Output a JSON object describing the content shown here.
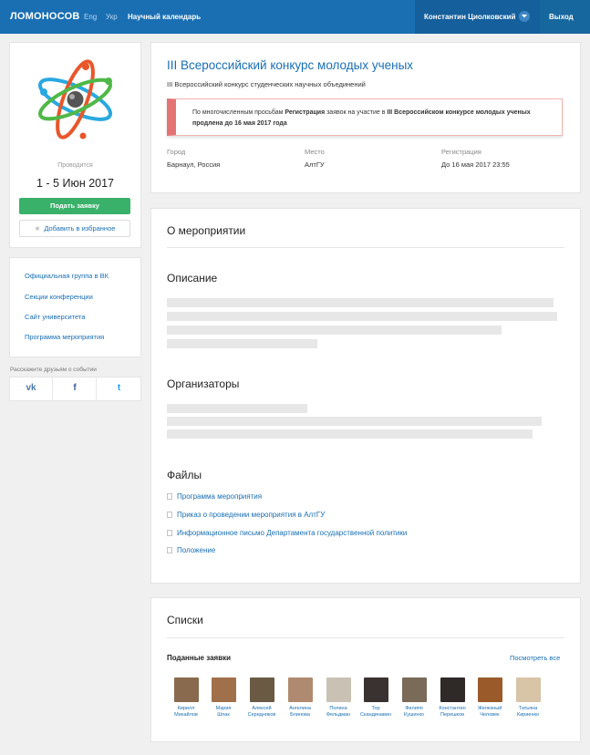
{
  "header": {
    "logo": "ЛОМОНОСОВ",
    "lang_eng": "Eng",
    "lang_ukr": "Укр",
    "nav_calendar": "Научный календарь",
    "user_name": "Константин Циолковский",
    "logout": "Выход"
  },
  "sidebar": {
    "held_label": "Проводится",
    "date_range": "1 - 5 Июн 2017",
    "apply_button": "Подать заявку",
    "favorite_button": "Добавить в избранное",
    "links": [
      {
        "label": "Официальная группа в ВК"
      },
      {
        "label": "Секции конференции"
      },
      {
        "label": "Сайт университета"
      },
      {
        "label": "Программа мероприятия"
      }
    ],
    "share_label": "Расскажите друзьям о событии",
    "share": [
      {
        "icon": "vk-icon",
        "glyph": "vk",
        "color": "#4a76a8"
      },
      {
        "icon": "facebook-icon",
        "glyph": "f",
        "color": "#3b5998"
      },
      {
        "icon": "twitter-icon",
        "glyph": "t",
        "color": "#1da1f2"
      }
    ]
  },
  "event": {
    "title": "III Всероссийский конкурс молодых ученых",
    "subtitle": "III Всероссийский конкурс студенческих научных объединений",
    "notice": {
      "part1": "По многочисленным просьбам ",
      "bold1": "Регистрация",
      "part2": " заявок на участие в ",
      "bold2": "III Всероссийском конкурсе молодых ученых продлена до 16 мая 2017 года"
    },
    "city_label": "Город",
    "city": "Барнаул, Россия",
    "place_label": "Место",
    "place": "АлтГУ",
    "registration_label": "Регистрация",
    "registration": "До 16 мая 2017 23:55"
  },
  "about": {
    "title": "О мероприятии",
    "description_title": "Описание",
    "organizers_title": "Организаторы",
    "files_title": "Файлы",
    "files": [
      {
        "label": "Программа мероприятия"
      },
      {
        "label": "Приказ о проведении мероприятия в АлтГУ"
      },
      {
        "label": "Информационное письмо Департамента государственной политики"
      },
      {
        "label": "Положение"
      }
    ]
  },
  "lists": {
    "title": "Списки",
    "submitted_title": "Поданные заявки",
    "see_all": "Посмотреть все",
    "people": [
      {
        "line1": "Кирилл",
        "line2": "Михайлов",
        "color": "#8a6a4e"
      },
      {
        "line1": "Мария",
        "line2": "Шпак",
        "color": "#a0704a"
      },
      {
        "line1": "Алексей",
        "line2": "Середняков",
        "color": "#6a5a44"
      },
      {
        "line1": "Ангелина",
        "line2": "Блинова",
        "color": "#b08a70"
      },
      {
        "line1": "Полина",
        "line2": "Фельдман",
        "color": "#c9c2b4"
      },
      {
        "line1": "Тор",
        "line2": "Скандинавин",
        "color": "#3a3230"
      },
      {
        "line1": "Филипп",
        "line2": "Кушенко",
        "color": "#7a6a58"
      },
      {
        "line1": "Константин",
        "line2": "Перешков",
        "color": "#2f2a28"
      },
      {
        "line1": "Железный",
        "line2": "Человек",
        "color": "#9a5a2a"
      },
      {
        "line1": "Татьяна",
        "line2": "Кириенко",
        "color": "#d8c4a6"
      }
    ]
  }
}
